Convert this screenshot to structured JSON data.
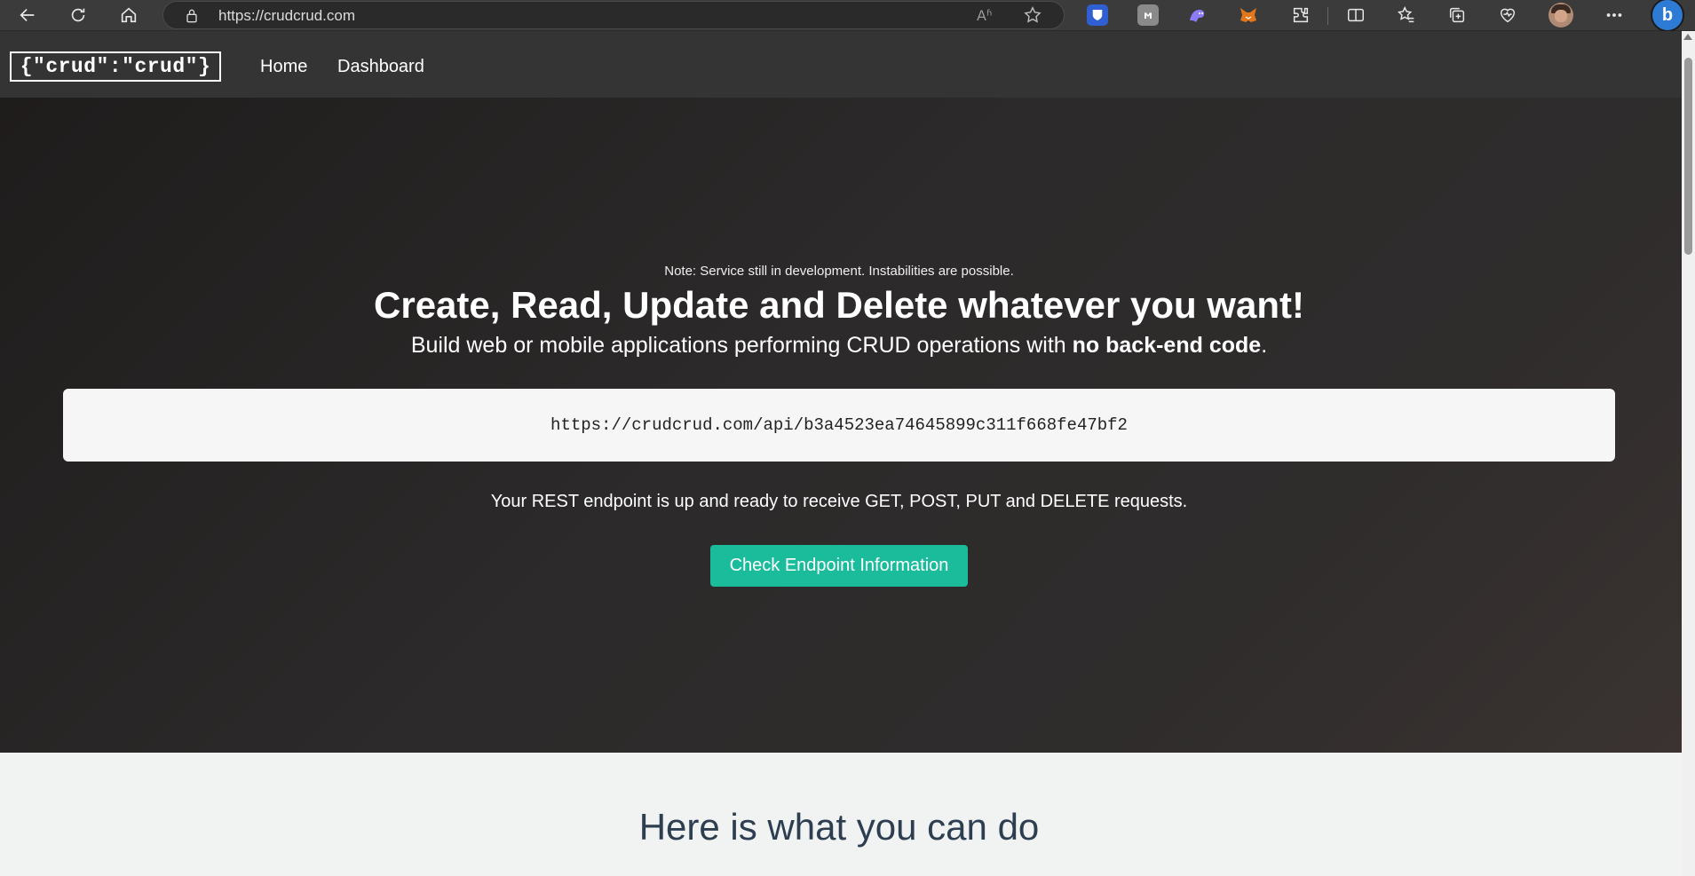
{
  "browser": {
    "url": "https://crudcrud.com",
    "read_aloud_glyph": "Aʱ"
  },
  "colors": {
    "accent": "#1abc9c",
    "navbar": "#343434",
    "features_bg": "#f1f3f3",
    "features_title": "#2c3e50"
  },
  "navbar": {
    "brand": "{\"crud\":\"crud\"}",
    "links": [
      "Home",
      "Dashboard"
    ]
  },
  "hero": {
    "note": "Note: Service still in development. Instabilities are possible.",
    "headline": "Create, Read, Update and Delete whatever you want!",
    "subtitle_prefix": "Build web or mobile applications performing CRUD operations with ",
    "subtitle_bold": "no back-end code",
    "subtitle_suffix": ".",
    "endpoint_url": "https://crudcrud.com/api/b3a4523ea74645899c311f668fe47bf2",
    "ready_text": "Your REST endpoint is up and ready to receive GET, POST, PUT and DELETE requests.",
    "button_label": "Check Endpoint Information"
  },
  "features": {
    "title": "Here is what you can do"
  }
}
